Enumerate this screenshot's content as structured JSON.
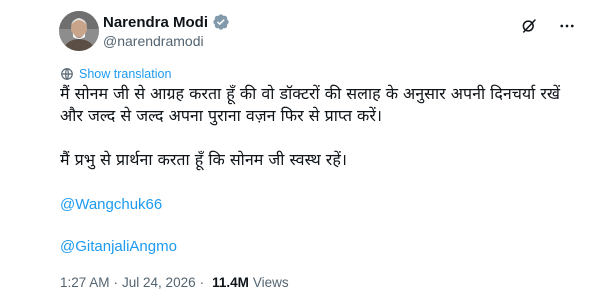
{
  "author": {
    "display_name": "Narendra Modi",
    "handle": "@narendramodi"
  },
  "icons": {
    "verified": "verified-badge-icon",
    "grok": "grok-icon",
    "more": "more-icon",
    "translate": "globe-icon"
  },
  "colors": {
    "link": "#1d9bf0",
    "secondary_text": "#536471",
    "primary_text": "#0f1419"
  },
  "translate_label": "Show translation",
  "body": {
    "line1": "मैं सोनम जी से आग्रह करता हूँ की वो डॉक्टरों की सलाह के अनुसार अपनी दिनचर्या रखें",
    "line2": "और जल्द से जल्द अपना पुराना वज़न फिर से प्राप्त करें।",
    "para2": "मैं प्रभु से प्रार्थना करता हूँ कि सोनम जी स्वस्थ रहें।"
  },
  "mentions": [
    "@Wangchuk66",
    "@GitanjaliAngmo"
  ],
  "meta": {
    "time": "1:27 AM",
    "separator": "·",
    "date": "Jul 24, 2026",
    "views_count": "11.4M",
    "views_label": "Views"
  }
}
